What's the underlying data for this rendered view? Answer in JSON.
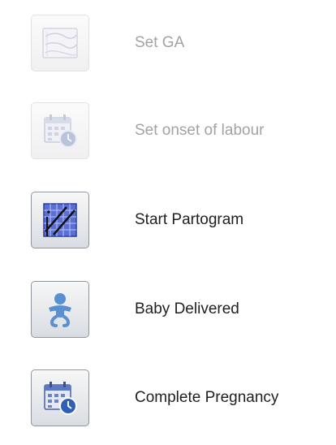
{
  "menu": {
    "items": [
      {
        "label": "Set GA",
        "icon": "ga-chart-icon",
        "enabled": false
      },
      {
        "label": "Set onset of labour",
        "icon": "calendar-clock-icon",
        "enabled": false
      },
      {
        "label": "Start Partogram",
        "icon": "partogram-graph-icon",
        "enabled": true
      },
      {
        "label": "Baby Delivered",
        "icon": "baby-icon",
        "enabled": true
      },
      {
        "label": "Complete Pregnancy",
        "icon": "calendar-clock-icon",
        "enabled": true
      }
    ]
  }
}
